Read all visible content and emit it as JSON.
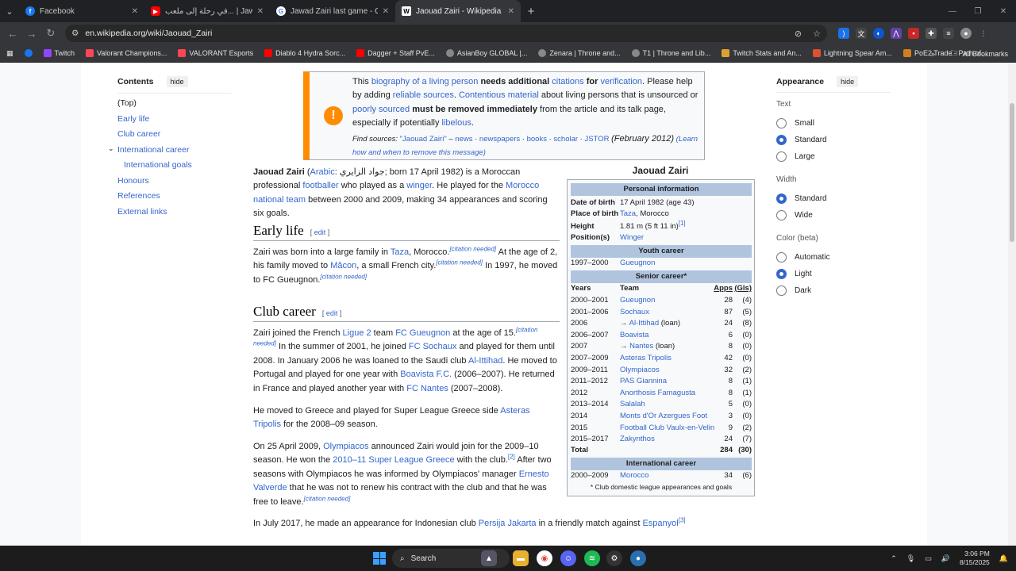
{
  "browser": {
    "tabs": [
      {
        "title": "Facebook",
        "color": "#1877f2",
        "glyph": "f"
      },
      {
        "title": "في رحلة إلى ملعب... | Jawad Zairi و أنا",
        "color": "#ff0000",
        "glyph": "▶"
      },
      {
        "title": "Jawad Zairi last game - Google",
        "color": "#4285f4",
        "glyph": "G"
      },
      {
        "title": "Jaouad Zairi - Wikipedia",
        "color": "#ffffff",
        "glyph": "W"
      }
    ],
    "url": "en.wikipedia.org/wiki/Jaouad_Zairi",
    "bookmarks": [
      "Twitch",
      "Valorant Champions...",
      "VALORANT Esports",
      "Diablo 4 Hydra Sorc...",
      "Dagger + Staff PvE...",
      "AsianBoy GLOBAL |...",
      "Zenara | Throne and...",
      "T1 | Throne and Lib...",
      "Twitch Stats and An...",
      "Lightning Spear Am...",
      "PoE2 Trade - Path of..."
    ],
    "all_bookmarks": "All Bookmarks"
  },
  "toc": {
    "heading": "Contents",
    "hide": "hide",
    "items": [
      {
        "label": "(Top)"
      },
      {
        "label": "Early life"
      },
      {
        "label": "Club career"
      },
      {
        "label": "International career"
      },
      {
        "label": "International goals"
      },
      {
        "label": "Honours"
      },
      {
        "label": "References"
      },
      {
        "label": "External links"
      }
    ]
  },
  "ambox": {
    "t1": "This",
    "l1": "biography of a living person",
    "t2": "needs additional",
    "l2": "citations",
    "t3": "for",
    "l3": "verification",
    "t4": ". Please help by adding",
    "l4": "reliable sources",
    "t5": ".",
    "l5": "Contentious material",
    "t6": "about living persons that is unsourced or",
    "l6": "poorly sourced",
    "t7": "must be removed immediately",
    "t8": "from the article and its talk page, especially if potentially",
    "l7": "libelous",
    "t9": ".",
    "fs_label": "Find sources:",
    "fs_q": "\"Jaouad Zairi\"",
    "fs_dash": "–",
    "fs_news": "news",
    "fs_papers": "newspapers",
    "fs_books": "books",
    "fs_scholar": "scholar",
    "fs_jstor": "JSTOR",
    "fs_date": "(February 2012)",
    "fs_learn": "(Learn how and when to remove this message)"
  },
  "intro": {
    "name": "Jaouad Zairi",
    "arabic": "Arabic",
    "arabic_txt": ": جواد الزايري; born 17 April 1982) is a Moroccan professional",
    "footballer": "footballer",
    "t1": "who played as a",
    "winger": "winger",
    "t2": ". He played for the",
    "nt": "Morocco national team",
    "t3": "between 2000 and 2009, making 34 appearances and scoring six goals."
  },
  "early": {
    "heading": "Early life",
    "edit": "edit",
    "t1": "Zairi was born into a large family in",
    "taza": "Taza",
    "t2": ", Morocco.",
    "cn": "[citation needed]",
    "t3": "At the age of 2, his family moved to",
    "macon": "Mâcon",
    "t4": ", a small French city.",
    "t5": "In 1997, he moved to FC Gueugnon."
  },
  "club": {
    "heading": "Club career",
    "edit": "edit",
    "p1a": "Zairi joined the French",
    "ligue2": "Ligue 2",
    "p1b": "team",
    "fcg": "FC Gueugnon",
    "p1c": "at the age of 15.",
    "cn": "[citation needed]",
    "p1d": "In the summer of 2001, he joined",
    "fcs": "FC Sochaux",
    "p1e": "and played for them until 2008. In January 2006 he was loaned to the Saudi club",
    "ittihad": "Al-Ittihad",
    "p1f": ". He moved to Portugal and played for one year with",
    "boavista": "Boavista F.C.",
    "p1g": "(2006–2007). He returned in France and played another year with",
    "nantes": "FC Nantes",
    "p1h": "(2007–2008).",
    "p2a": "He moved to Greece and played for Super League Greece side",
    "asteras": "Asteras Tripolis",
    "p2b": "for the 2008–09 season.",
    "p3a": "On 25 April 2009,",
    "oly": "Olympiacos",
    "p3b": "announced Zairi would join for the 2009–10 season. He won the",
    "slg": "2010–11 Super League Greece",
    "p3c": "with the club.",
    "ref2": "[2]",
    "p3d": "After two seasons with Olympiacos he was informed by Olympiacos' manager",
    "valverde": "Ernesto Valverde",
    "p3e": "that he was not to renew his contract with the club and that he was free to leave.",
    "p4a": "In July 2017, he made an appearance for Indonesian club",
    "persija": "Persija Jakarta",
    "p4b": "in a friendly match against",
    "espanyol": "Espanyol",
    "ref3": "[3]"
  },
  "infobox": {
    "title": "Jaouad Zairi",
    "personal": "Personal information",
    "dob_l": "Date of birth",
    "dob": "17 April 1982 (age 43)",
    "pob_l": "Place of birth",
    "pob_city": "Taza",
    "pob_rest": ", Morocco",
    "height_l": "Height",
    "height": "1.81 m (5 ft 11 in)",
    "ref1": "[1]",
    "pos_l": "Position(s)",
    "pos": "Winger",
    "youth": "Youth career",
    "youth_years": "1997–2000",
    "youth_team": "Gueugnon",
    "senior": "Senior career*",
    "col_years": "Years",
    "col_team": "Team",
    "col_apps": "Apps",
    "col_gls": "(Gls)",
    "rows": [
      {
        "years": "2000–2001",
        "team": "Gueugnon",
        "pre": "",
        "post": "",
        "apps": "28",
        "gls": "(4)"
      },
      {
        "years": "2001–2006",
        "team": "Sochaux",
        "pre": "",
        "post": "",
        "apps": "87",
        "gls": "(5)"
      },
      {
        "years": "2006",
        "team": "Al-Ittihad",
        "pre": "→ ",
        "post": " (loan)",
        "apps": "24",
        "gls": "(8)"
      },
      {
        "years": "2006–2007",
        "team": "Boavista",
        "pre": "",
        "post": "",
        "apps": "6",
        "gls": "(0)"
      },
      {
        "years": "2007",
        "team": "Nantes",
        "pre": "→ ",
        "post": " (loan)",
        "apps": "8",
        "gls": "(0)"
      },
      {
        "years": "2007–2009",
        "team": "Asteras Tripolis",
        "pre": "",
        "post": "",
        "apps": "42",
        "gls": "(0)"
      },
      {
        "years": "2009–2011",
        "team": "Olympiacos",
        "pre": "",
        "post": "",
        "apps": "32",
        "gls": "(2)"
      },
      {
        "years": "2011–2012",
        "team": "PAS Giannina",
        "pre": "",
        "post": "",
        "apps": "8",
        "gls": "(1)"
      },
      {
        "years": "2012",
        "team": "Anorthosis Famagusta",
        "pre": "",
        "post": "",
        "apps": "8",
        "gls": "(1)"
      },
      {
        "years": "2013–2014",
        "team": "Salalah",
        "pre": "",
        "post": "",
        "apps": "5",
        "gls": "(0)"
      },
      {
        "years": "2014",
        "team": "Monts d'Or Azergues Foot",
        "pre": "",
        "post": "",
        "apps": "3",
        "gls": "(0)"
      },
      {
        "years": "2015",
        "team": "Football Club Vaulx-en-Velin",
        "pre": "",
        "post": "",
        "apps": "9",
        "gls": "(2)"
      },
      {
        "years": "2015–2017",
        "team": "Zakynthos",
        "pre": "",
        "post": "",
        "apps": "24",
        "gls": "(7)"
      }
    ],
    "total_l": "Total",
    "total_apps": "284",
    "total_gls": "(30)",
    "intl": "International career",
    "intl_years": "2000–2009",
    "intl_team": "Morocco",
    "intl_apps": "34",
    "intl_gls": "(6)",
    "foot": "* Club domestic league appearances and goals"
  },
  "appearance": {
    "heading": "Appearance",
    "hide": "hide",
    "text_l": "Text",
    "text_opts": [
      "Small",
      "Standard",
      "Large"
    ],
    "width_l": "Width",
    "width_opts": [
      "Standard",
      "Wide"
    ],
    "color_l": "Color (beta)",
    "color_opts": [
      "Automatic",
      "Light",
      "Dark"
    ]
  },
  "taskbar": {
    "search": "Search",
    "time": "3:06 PM",
    "date": "8/15/2025"
  }
}
